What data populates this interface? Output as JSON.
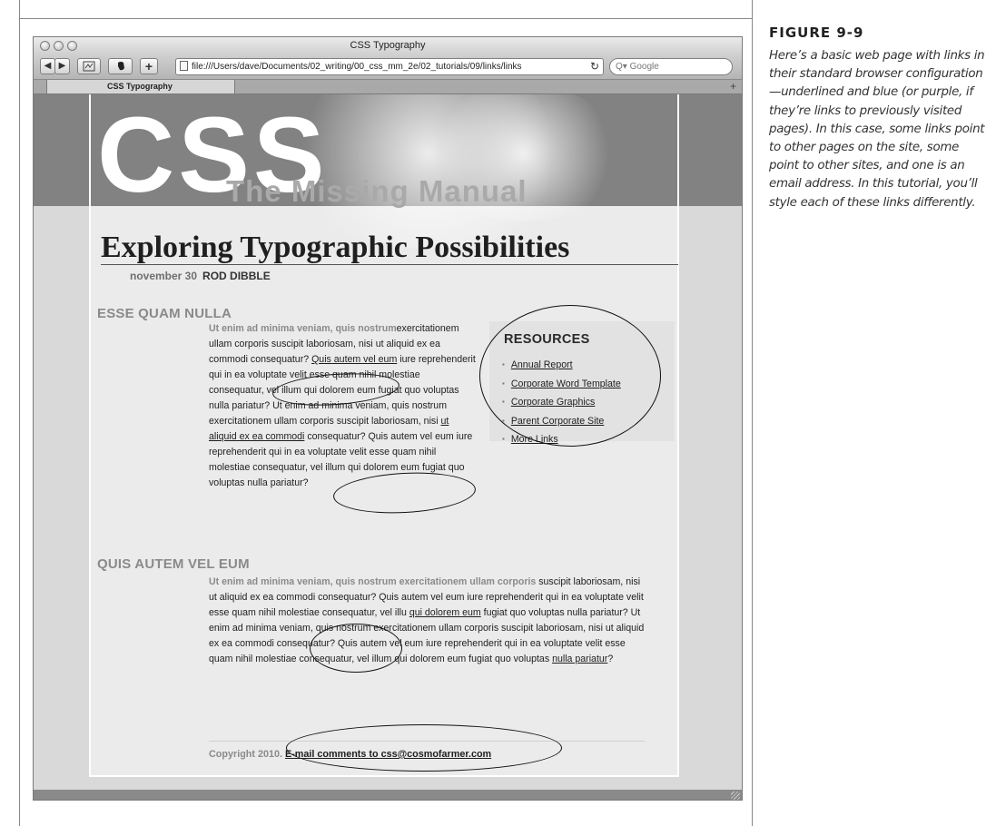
{
  "figure": {
    "label": "FIGURE 9-9",
    "caption": "Here’s a basic web page with links in their standard browser configuration—underlined and blue (or purple, if they’re links to previously visited pages). In this case, some links point to other pages on the site, some point to other sites, and one is an email address. In this tutorial, you’ll style each of these links differently."
  },
  "browser": {
    "window_title": "CSS Typography",
    "url": "file:///Users/dave/Documents/02_writing/00_css_mm_2e/02_tutorials/09/links/links",
    "search_placeholder": "Google",
    "tab_label": "CSS Typography",
    "back_icon": "◀",
    "forward_icon": "▶",
    "add_icon": "+",
    "reload_icon": "↻",
    "new_tab_icon": "+"
  },
  "page": {
    "logo": {
      "main": "CSS",
      "sub": "The Missing Manual"
    },
    "headline": "Exploring Typographic Possibilities",
    "byline": {
      "date": "november 30",
      "author": "ROD DIBBLE"
    },
    "section1": {
      "heading": "ESSE QUAM NULLA",
      "lead": "Ut enim ad minima veniam, quis nostrum",
      "text_a": "exercitationem ullam corporis suscipit laboriosam, nisi ut aliquid ex ea commodi consequatur? ",
      "link_a": "Quis autem vel eum",
      "text_b": " iure reprehenderit qui in ea voluptate velit esse quam nihil molestiae consequatur, vel illum qui dolorem eum fugiat quo voluptas nulla pariatur? Ut enim ad minima veniam, quis nostrum exercitationem ullam corporis suscipit laboriosam, nisi ",
      "link_b": "ut aliquid ex ea commodi",
      "text_c": " consequatur? Quis autem vel eum iure reprehenderit qui in ea voluptate velit esse quam nihil molestiae consequatur, vel illum qui dolorem eum fugiat quo voluptas nulla pariatur?"
    },
    "section2": {
      "heading": "QUIS AUTEM VEL EUM",
      "lead": "Ut enim ad minima veniam, quis nostrum exercitationem ullam corporis",
      "text_a": " suscipit laboriosam, nisi ut aliquid ex ea commodi consequatur? Quis autem vel eum iure reprehenderit qui in ea voluptate velit esse quam nihil molestiae consequatur, vel illu ",
      "link_a": "qui dolorem eum",
      "text_b": " fugiat quo voluptas nulla pariatur? Ut enim ad minima veniam, quis nostrum exercitationem ullam corporis suscipit laboriosam, nisi ut aliquid ex ea commodi consequatur? Quis autem vel eum iure reprehenderit qui in ea voluptate velit esse quam nihil molestiae consequatur, vel illum qui dolorem eum fugiat quo voluptas ",
      "link_b": "nulla pariatur",
      "text_c": "?"
    },
    "resources": {
      "title": "RESOURCES",
      "links": [
        "Annual Report",
        "Corporate Word Template",
        "Corporate Graphics",
        "Parent Corporate Site",
        "More Links"
      ]
    },
    "footer": {
      "copyright": "Copyright 2010. ",
      "email_link": "E-mail comments to css@cosmofarmer.com"
    }
  }
}
